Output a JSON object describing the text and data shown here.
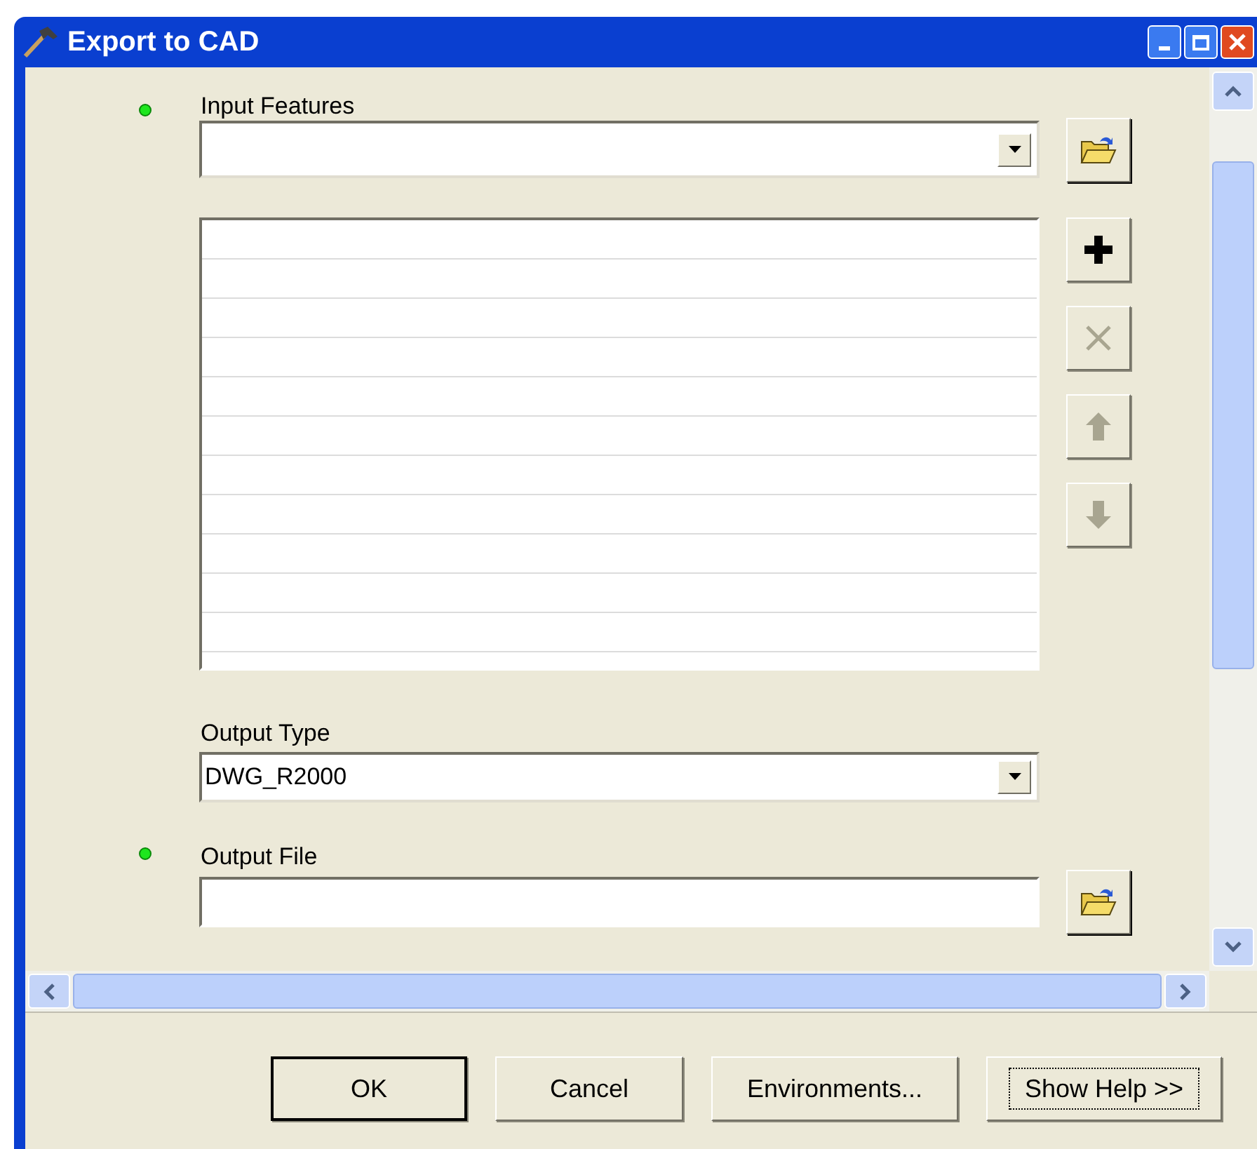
{
  "window": {
    "title": "Export to CAD"
  },
  "input_features": {
    "label": "Input Features",
    "required": true
  },
  "list_buttons": [
    {
      "kind": "add",
      "disabled": false
    },
    {
      "kind": "remove",
      "disabled": true
    },
    {
      "kind": "up",
      "disabled": true
    },
    {
      "kind": "down",
      "disabled": true
    }
  ],
  "output_type": {
    "label": "Output Type",
    "value": "DWG_R2000",
    "required": false
  },
  "output_file": {
    "label": "Output File",
    "required": true
  },
  "buttons": [
    {
      "label": "OK",
      "default": true,
      "focused": false
    },
    {
      "label": "Cancel",
      "default": false,
      "focused": false
    },
    {
      "label": "Environments...",
      "default": false,
      "focused": false
    },
    {
      "label": "Show Help >>",
      "default": false,
      "focused": true
    }
  ]
}
